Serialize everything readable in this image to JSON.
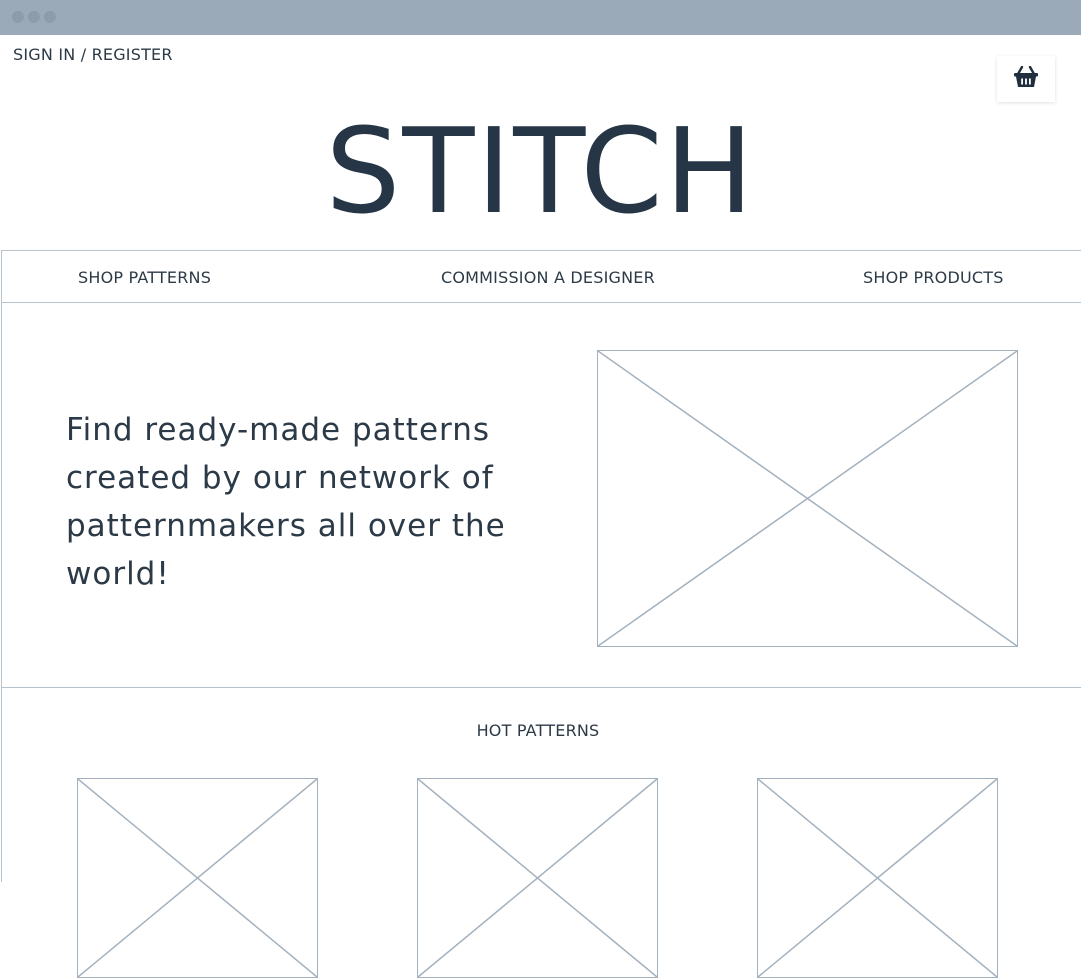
{
  "window": {
    "controls": [
      "close",
      "minimize",
      "maximize"
    ]
  },
  "header": {
    "sign_in_label": "SIGN IN / REGISTER",
    "cart_icon": "basket-icon",
    "logo_text": "STITCH"
  },
  "nav": {
    "items": [
      {
        "label": "SHOP PATTERNS"
      },
      {
        "label": "COMMISSION A DESIGNER"
      },
      {
        "label": "SHOP PRODUCTS"
      }
    ]
  },
  "hero": {
    "text": "Find ready-made patterns created by our  network of patternmakers all over the world!",
    "image": "image-placeholder"
  },
  "hot_patterns": {
    "title": "HOT PATTERNS",
    "items": [
      "image-placeholder",
      "image-placeholder",
      "image-placeholder"
    ]
  },
  "colors": {
    "window_bar": "#9baab8",
    "text": "#2c3a47",
    "placeholder_stroke": "#a3b1be",
    "border": "#b6c2cd"
  }
}
